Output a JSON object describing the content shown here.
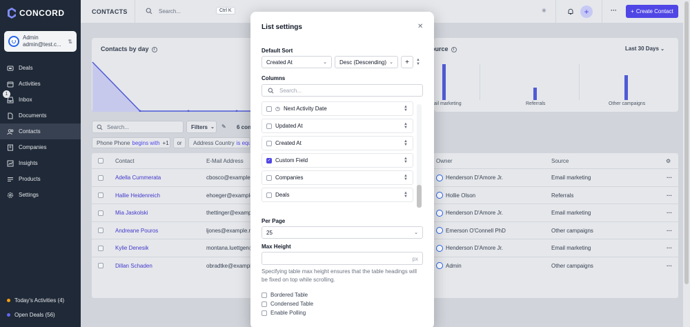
{
  "app": {
    "name": "CONCORD"
  },
  "user": {
    "name": "Admin",
    "email": "admin@test.c..."
  },
  "nav": [
    {
      "label": "Deals",
      "icon": "deals-icon"
    },
    {
      "label": "Activities",
      "icon": "calendar-icon"
    },
    {
      "label": "Inbox",
      "icon": "inbox-icon",
      "badge": "1"
    },
    {
      "label": "Documents",
      "icon": "document-icon"
    },
    {
      "label": "Contacts",
      "icon": "users-icon",
      "active": true
    },
    {
      "label": "Companies",
      "icon": "building-icon"
    },
    {
      "label": "Insights",
      "icon": "chart-icon"
    },
    {
      "label": "Products",
      "icon": "list-icon"
    },
    {
      "label": "Settings",
      "icon": "gear-icon"
    }
  ],
  "sidebar_bottom": {
    "today_activities": "Today's Activities (4)",
    "open_deals": "Open Deals (56)"
  },
  "topbar": {
    "title": "CONTACTS",
    "search_placeholder": "Search...",
    "shortcut": "Ctrl K",
    "create_label": "Create Contact"
  },
  "cards": {
    "contacts_by_day": "Contacts by day",
    "source_title": "ource",
    "range": "Last 30 Days",
    "source_labels": [
      "ail marketing",
      "Referrals",
      "Other campaigns"
    ]
  },
  "toolbar": {
    "search_placeholder": "Search...",
    "filters": "Filters",
    "count": "6 con",
    "chip1_text": "Phone Phone",
    "chip1_hl": "begins with",
    "chip1_more": "+1",
    "or": "or",
    "chip2_text": "Address Country",
    "chip2_hl": "is equa"
  },
  "table": {
    "headers": {
      "contact": "Contact",
      "email": "E-Mail Address",
      "owner": "Owner",
      "source": "Source"
    },
    "rows": [
      {
        "name": "Adella Cummerata",
        "email": "cbosco@example.",
        "owner": "Henderson D'Amore Jr.",
        "source": "Email marketing"
      },
      {
        "name": "Hallie Heidenreich",
        "email": "ehoeger@example.",
        "owner": "Hollie Olson",
        "source": "Referrals"
      },
      {
        "name": "Mia Jaskolski",
        "email": "thettinger@exampl",
        "owner": "Henderson D'Amore Jr.",
        "source": "Email marketing"
      },
      {
        "name": "Andreane Pouros",
        "email": "ljones@example.n",
        "owner": "Emerson O'Connell PhD",
        "source": "Other campaigns"
      },
      {
        "name": "Kylie Denesik",
        "email": "montana.luettgen@",
        "owner": "Henderson D'Amore Jr.",
        "source": "Email marketing"
      },
      {
        "name": "Dillan Schaden",
        "email": "obradtke@exampl",
        "owner": "Admin",
        "source": "Other campaigns"
      }
    ]
  },
  "modal": {
    "title": "List settings",
    "default_sort_label": "Default Sort",
    "sort_field": "Created At",
    "sort_dir": "Desc (Descending)",
    "columns_label": "Columns",
    "columns_search_placeholder": "Search...",
    "columns": [
      {
        "label": "Next Activity Date",
        "checked": false,
        "clock": true
      },
      {
        "label": "Updated At",
        "checked": false
      },
      {
        "label": "Created At",
        "checked": false
      },
      {
        "label": "Custom Field",
        "checked": true
      },
      {
        "label": "Companies",
        "checked": false
      },
      {
        "label": "Deals",
        "checked": false
      }
    ],
    "per_page_label": "Per Page",
    "per_page_value": "25",
    "max_height_label": "Max Height",
    "max_height_suffix": "px",
    "max_height_help": "Specifying table max height ensures that the table headings will be fixed on top while scrolling.",
    "options": [
      "Bordered Table",
      "Condensed Table",
      "Enable Polling"
    ]
  },
  "colors": {
    "accent": "#4f46e5",
    "sidebar": "#1f2937",
    "owner_ring": "#2563eb",
    "chart_fill": "#4f5bd5"
  }
}
